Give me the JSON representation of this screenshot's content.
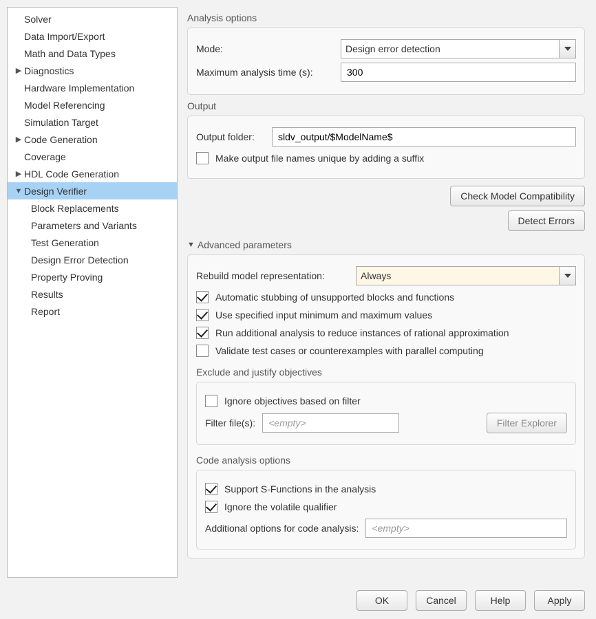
{
  "sidebar": {
    "items": [
      {
        "label": "Solver",
        "level": 0,
        "arrow": ""
      },
      {
        "label": "Data Import/Export",
        "level": 0,
        "arrow": ""
      },
      {
        "label": "Math and Data Types",
        "level": 0,
        "arrow": ""
      },
      {
        "label": "Diagnostics",
        "level": 0,
        "arrow": "▶"
      },
      {
        "label": "Hardware Implementation",
        "level": 0,
        "arrow": ""
      },
      {
        "label": "Model Referencing",
        "level": 0,
        "arrow": ""
      },
      {
        "label": "Simulation Target",
        "level": 0,
        "arrow": ""
      },
      {
        "label": "Code Generation",
        "level": 0,
        "arrow": "▶"
      },
      {
        "label": "Coverage",
        "level": 0,
        "arrow": ""
      },
      {
        "label": "HDL Code Generation",
        "level": 0,
        "arrow": "▶"
      },
      {
        "label": "Design Verifier",
        "level": 0,
        "arrow": "▼",
        "selected": true
      },
      {
        "label": "Block Replacements",
        "level": 1,
        "arrow": ""
      },
      {
        "label": "Parameters and Variants",
        "level": 1,
        "arrow": ""
      },
      {
        "label": "Test Generation",
        "level": 1,
        "arrow": ""
      },
      {
        "label": "Design Error Detection",
        "level": 1,
        "arrow": ""
      },
      {
        "label": "Property Proving",
        "level": 1,
        "arrow": ""
      },
      {
        "label": "Results",
        "level": 1,
        "arrow": ""
      },
      {
        "label": "Report",
        "level": 1,
        "arrow": ""
      }
    ]
  },
  "analysis_options": {
    "title": "Analysis options",
    "mode_label": "Mode:",
    "mode_value": "Design error detection",
    "max_time_label": "Maximum analysis time (s):",
    "max_time_value": "300"
  },
  "output": {
    "title": "Output",
    "folder_label": "Output folder:",
    "folder_value": "sldv_output/$ModelName$",
    "unique_label": "Make output file names unique by adding a suffix",
    "unique_checked": false
  },
  "action_buttons": {
    "check_compat": "Check Model Compatibility",
    "detect_errors": "Detect Errors"
  },
  "advanced": {
    "title": "Advanced parameters",
    "rebuild_label": "Rebuild model representation:",
    "rebuild_value": "Always",
    "auto_stub_label": "Automatic stubbing of unsupported blocks and functions",
    "auto_stub_checked": true,
    "use_minmax_label": "Use specified input minimum and maximum values",
    "use_minmax_checked": true,
    "rational_label": "Run additional analysis to reduce instances of rational approximation",
    "rational_checked": true,
    "validate_parallel_label": "Validate test cases or counterexamples with parallel computing",
    "validate_parallel_checked": false,
    "exclude": {
      "title": "Exclude and justify objectives",
      "ignore_label": "Ignore objectives based on filter",
      "ignore_checked": false,
      "filter_label": "Filter file(s):",
      "filter_placeholder": "<empty>",
      "explorer_btn": "Filter Explorer"
    },
    "code_analysis": {
      "title": "Code analysis options",
      "sfun_label": "Support S-Functions in the analysis",
      "sfun_checked": true,
      "volatile_label": "Ignore the volatile qualifier",
      "volatile_checked": true,
      "addopts_label": "Additional options for code analysis:",
      "addopts_placeholder": "<empty>"
    }
  },
  "footer": {
    "ok": "OK",
    "cancel": "Cancel",
    "help": "Help",
    "apply": "Apply"
  }
}
